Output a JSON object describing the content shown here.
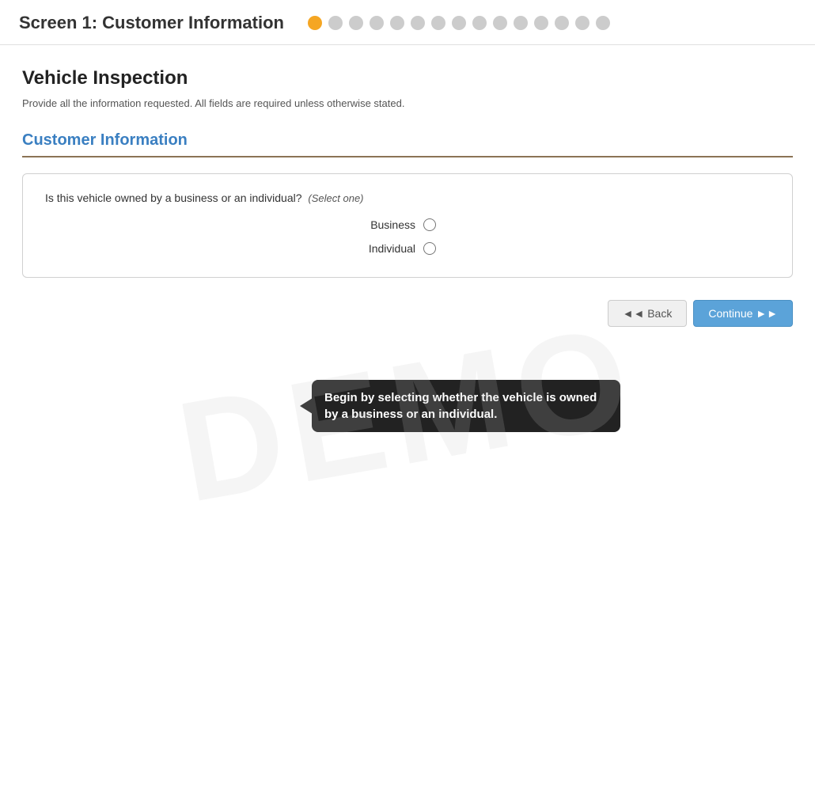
{
  "header": {
    "screen_title": "Screen 1: Customer Information",
    "progress": {
      "total_dots": 15,
      "active_dot": 0
    }
  },
  "page": {
    "title": "Vehicle Inspection",
    "subtitle": "Provide all the information requested. All fields are required unless otherwise stated.",
    "section_title": "Customer Information"
  },
  "form": {
    "question": "Is this vehicle owned by a business or an individual?",
    "select_hint": "(Select one)",
    "options": [
      {
        "label": "Business",
        "value": "business"
      },
      {
        "label": "Individual",
        "value": "individual"
      }
    ]
  },
  "tooltip": {
    "text": "Begin by selecting whether the vehicle is owned by a business or an individual."
  },
  "navigation": {
    "back_label": "◄◄ Back",
    "continue_label": "Continue ►►"
  },
  "watermark": "DEMO"
}
